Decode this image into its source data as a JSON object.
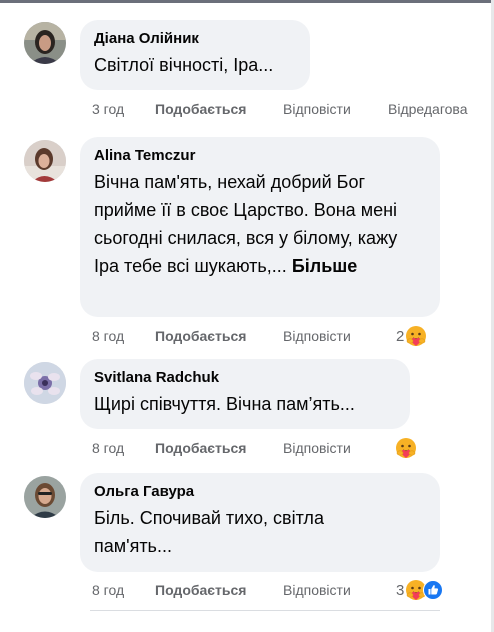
{
  "comments": [
    {
      "author": "Діана Олійник",
      "text": "Світлої вічності, Іра...",
      "time": "3 год",
      "like_label": "Подобається",
      "reply_label": "Відповісти",
      "extra_label": "Відредагова"
    },
    {
      "author": "Alina Temczur",
      "text": "Вічна пам'ять, нехай добрий Бог прийме її в своє Царство. Вона мені сьогодні снилася, вся у білому, кажу Іра тебе всі шукають,...",
      "more_label": "Більше",
      "time": "8 год",
      "like_label": "Подобається",
      "reply_label": "Відповісти",
      "reaction_count": "2",
      "reaction_icon": "care-emoji"
    },
    {
      "author": "Svitlana Radchuk",
      "text": "Щирі співчуття. Вічна пам’ять...",
      "time": "8 год",
      "like_label": "Подобається",
      "reply_label": "Відповісти",
      "reaction_icon": "care-emoji"
    },
    {
      "author": "Ольга Гавура",
      "text": "Біль. Спочивай тихо, світла пам'ять...",
      "time": "8 год",
      "like_label": "Подобається",
      "reply_label": "Відповісти",
      "reaction_count": "3",
      "reaction_icon": "care-emoji",
      "reaction_icon_2": "like-icon"
    }
  ],
  "colors": {
    "bubble": "#f0f2f5",
    "secondary_text": "#65676b",
    "like_blue": "#1877f2",
    "care_yellow": "#f7b125"
  }
}
